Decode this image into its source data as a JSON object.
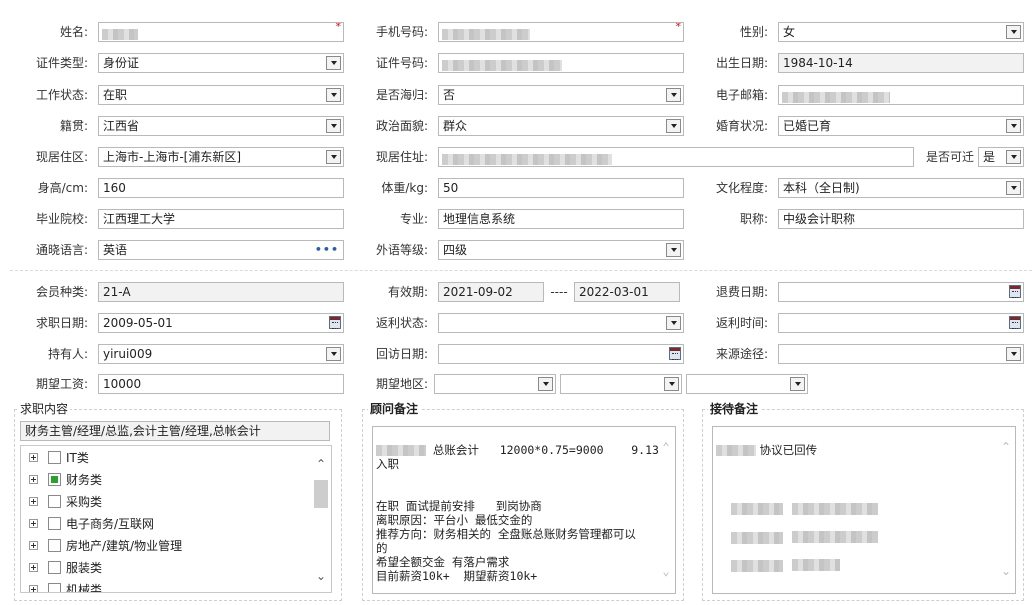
{
  "profile": {
    "name": {
      "label": "姓名:",
      "required_mark": "*"
    },
    "phone": {
      "label": "手机号码:",
      "required_mark": "*"
    },
    "gender": {
      "label": "性别:",
      "value": "女"
    },
    "id_type": {
      "label": "证件类型:",
      "value": "身份证"
    },
    "id_number": {
      "label": "证件号码:"
    },
    "birth_date": {
      "label": "出生日期:",
      "value": "1984-10-14"
    },
    "work_status": {
      "label": "工作状态:",
      "value": "在职"
    },
    "returnee": {
      "label": "是否海归:",
      "value": "否"
    },
    "email": {
      "label": "电子邮箱:"
    },
    "native_place": {
      "label": "籍贯:",
      "value": "江西省"
    },
    "political": {
      "label": "政治面貌:",
      "value": "群众"
    },
    "marital": {
      "label": "婚育状况:",
      "value": "已婚已育"
    },
    "residence_area": {
      "label": "现居住区:",
      "value": "上海市-上海市-[浦东新区]"
    },
    "address": {
      "label": "现居住址:"
    },
    "reachable": {
      "label": "是否可迁",
      "value": "是"
    },
    "height": {
      "label": "身高/cm:",
      "value": "160"
    },
    "weight": {
      "label": "体重/kg:",
      "value": "50"
    },
    "education": {
      "label": "文化程度:",
      "value": "本科（全日制)"
    },
    "school": {
      "label": "毕业院校:",
      "value": "江西理工大学"
    },
    "major": {
      "label": "专业:",
      "value": "地理信息系统"
    },
    "title": {
      "label": "职称:",
      "value": "中级会计职称"
    },
    "language": {
      "label": "通晓语言:",
      "value": "英语",
      "more": "•••"
    },
    "lang_level": {
      "label": "外语等级:",
      "value": "四级"
    }
  },
  "membership": {
    "member_type": {
      "label": "会员种类:",
      "value": "21-A"
    },
    "validity": {
      "label": "有效期:",
      "start": "2021-09-02",
      "sep": "----",
      "end": "2022-03-01"
    },
    "refund_date": {
      "label": "退费日期:",
      "value": ""
    },
    "apply_date": {
      "label": "求职日期:",
      "value": "2009-05-01"
    },
    "rebate_status": {
      "label": "返利状态:",
      "value": ""
    },
    "rebate_time": {
      "label": "返利时间:",
      "value": ""
    },
    "holder": {
      "label": "持有人:",
      "value": "yirui009"
    },
    "revisit_date": {
      "label": "回访日期:",
      "value": ""
    },
    "source": {
      "label": "来源途径:",
      "value": ""
    },
    "expected_salary": {
      "label": "期望工资:",
      "value": "10000"
    },
    "expected_area": {
      "label": "期望地区:"
    }
  },
  "job": {
    "title": "求职内容",
    "summary": "财务主管/经理/总监,会计主管/经理,总帐会计",
    "categories": [
      {
        "label": "IT类",
        "checked": false
      },
      {
        "label": "财务类",
        "checked": true
      },
      {
        "label": "采购类",
        "checked": false
      },
      {
        "label": "电子商务/互联网",
        "checked": false
      },
      {
        "label": "房地产/建筑/物业管理",
        "checked": false
      },
      {
        "label": "服装类",
        "checked": false
      },
      {
        "label": "机械类",
        "checked": false
      }
    ]
  },
  "consultant_notes": {
    "title": "顾问备注",
    "lines": [
      " 总账会计   12000*0.75=9000    9.13",
      "入职",
      "",
      "",
      "在职 面试提前安排   到岗协商",
      "离职原因：平台小 最低交金的",
      "推荐方向：财务相关的 全盘账总账财务管理都可以",
      "的",
      "希望全额交金 有落户需求",
      "目前薪资10k+  期望薪资10k+"
    ]
  },
  "reception_notes": {
    "title": "接待备注",
    "first_line": " 协议已回传"
  },
  "colors": {
    "checked": "#2aa12a",
    "required": "#e00000",
    "ellipsis": "#2a5db0"
  }
}
